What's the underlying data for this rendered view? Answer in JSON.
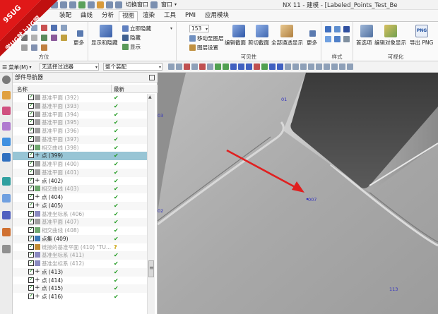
{
  "window": {
    "title": "NX 11 - 建模 - [Labeled_Points_Test_Be",
    "quick_access": {
      "switch_window": "切换窗口",
      "window_menu": "窗口"
    }
  },
  "watermark": {
    "line1": "9SUG",
    "line2": "学UG就上UG网"
  },
  "menu_tabs": [
    {
      "label": "装配",
      "active": false
    },
    {
      "label": "曲线",
      "active": false
    },
    {
      "label": "分析",
      "active": false
    },
    {
      "label": "视图",
      "active": true
    },
    {
      "label": "渲染",
      "active": false
    },
    {
      "label": "工具",
      "active": false
    },
    {
      "label": "PMI",
      "active": false
    },
    {
      "label": "应用模块",
      "active": false
    }
  ],
  "ribbon": {
    "orient_group": {
      "label": "方位",
      "more": "更多"
    },
    "show_hide_group": {
      "show_hide": "显示和隐藏",
      "immediate_hide": "立即隐藏",
      "hide": "隐藏",
      "show": "显示"
    },
    "visibility_group": {
      "label": "可见性",
      "layer_number": "153",
      "move_to_layer": "移动至图层",
      "layer_settings": "图层设置",
      "edit_section": "编辑截面",
      "clip_section": "剪切截面",
      "show_all_views": "全部通透显示",
      "more": "更多"
    },
    "style_group": {
      "label": "样式"
    },
    "visualization_group": {
      "label": "可视化",
      "preferences": "首选项",
      "edit_object_display": "编辑对象显示",
      "export_png": "导出 PNG",
      "png_badge": "PNG"
    }
  },
  "selection_bar": {
    "menu": "菜单(M)",
    "filter": "无选择过滤器",
    "scope": "整个装配"
  },
  "part_navigator": {
    "title": "部件导航器",
    "col_name": "名称",
    "col_latest": "最新",
    "rows": [
      {
        "label": "基准平面 (392)",
        "grey": true,
        "mark": "✔",
        "icon": "plane"
      },
      {
        "label": "基准平面 (393)",
        "grey": true,
        "mark": "✔",
        "icon": "plane"
      },
      {
        "label": "基准平面 (394)",
        "grey": true,
        "mark": "✔",
        "icon": "plane"
      },
      {
        "label": "基准平面 (395)",
        "grey": true,
        "mark": "✔",
        "icon": "plane"
      },
      {
        "label": "基准平面 (396)",
        "grey": true,
        "mark": "✔",
        "icon": "plane"
      },
      {
        "label": "基准平面 (397)",
        "grey": true,
        "mark": "✔",
        "icon": "plane"
      },
      {
        "label": "相交曲线 (398)",
        "grey": true,
        "mark": "✔",
        "icon": "curve"
      },
      {
        "label": "点 (399)",
        "grey": false,
        "mark": "✔",
        "icon": "point",
        "selected": true
      },
      {
        "label": "基准平面 (400)",
        "grey": true,
        "mark": "✔",
        "icon": "plane"
      },
      {
        "label": "基准平面 (401)",
        "grey": true,
        "mark": "✔",
        "icon": "plane"
      },
      {
        "label": "点 (402)",
        "grey": false,
        "mark": "✔",
        "icon": "point"
      },
      {
        "label": "相交曲线 (403)",
        "grey": true,
        "mark": "✔",
        "icon": "curve"
      },
      {
        "label": "点 (404)",
        "grey": false,
        "mark": "✔",
        "icon": "point"
      },
      {
        "label": "点 (405)",
        "grey": false,
        "mark": "✔",
        "icon": "point"
      },
      {
        "label": "基准坐标系 (406)",
        "grey": true,
        "mark": "✔",
        "icon": "csys"
      },
      {
        "label": "基准平面 (407)",
        "grey": true,
        "mark": "✔",
        "icon": "plane"
      },
      {
        "label": "相交曲线 (408)",
        "grey": true,
        "mark": "✔",
        "icon": "curve"
      },
      {
        "label": "点集 (409)",
        "grey": false,
        "mark": "✔",
        "icon": "pointset"
      },
      {
        "label": "链接的基准平面 (410) \"TU...",
        "grey": true,
        "mark": "?",
        "icon": "link"
      },
      {
        "label": "基准坐标系 (411)",
        "grey": true,
        "mark": "✔",
        "icon": "csys"
      },
      {
        "label": "基准坐标系 (412)",
        "grey": true,
        "mark": "✔",
        "icon": "csys"
      },
      {
        "label": "点 (413)",
        "grey": false,
        "mark": "✔",
        "icon": "point"
      },
      {
        "label": "点 (414)",
        "grey": false,
        "mark": "✔",
        "icon": "point"
      },
      {
        "label": "点 (415)",
        "grey": false,
        "mark": "✔",
        "icon": "point"
      },
      {
        "label": "点 (416)",
        "grey": false,
        "mark": "✔",
        "icon": "point"
      }
    ]
  },
  "graphics": {
    "labels": {
      "p1": "01",
      "p2": "03",
      "p3": "02",
      "p4": "007",
      "p5": "113"
    },
    "arrow_color": "#e02020",
    "point_color": "#3030c0"
  }
}
